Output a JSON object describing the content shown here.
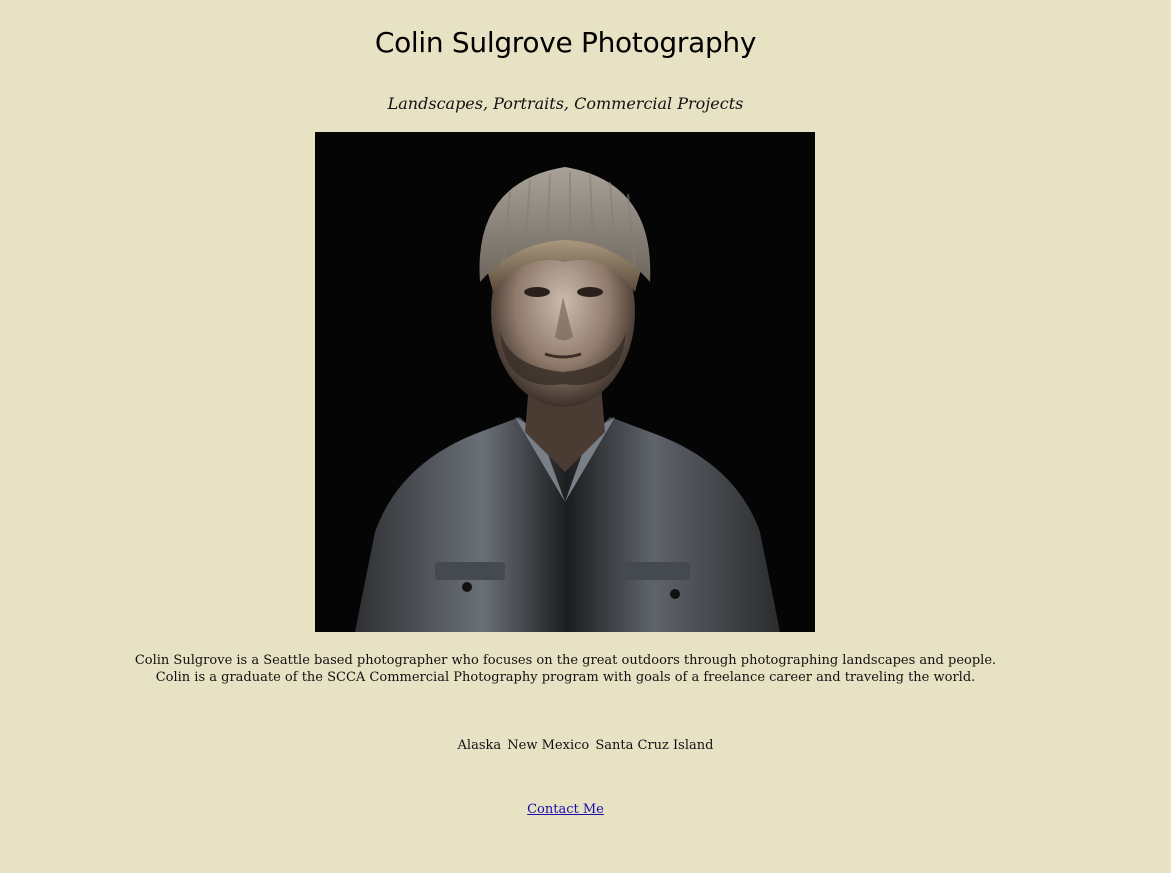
{
  "header": {
    "title": "Colin Sulgrove Photography",
    "tagline": "Landscapes, Portraits, Commercial Projects"
  },
  "portrait": {
    "subject": "portrait-photo"
  },
  "bio": {
    "line1": "Colin Sulgrove is a Seattle based photographer who focuses on the great outdoors through photographing landscapes and people.",
    "line2": "Colin is a graduate of the SCCA Commercial Photography program with goals of a freelance career and traveling the world."
  },
  "galleries": {
    "items": [
      "Alaska",
      "New Mexico",
      "Santa Cruz Island"
    ]
  },
  "contact": {
    "label": "Contact Me"
  },
  "colors": {
    "background": "#e6e2c3",
    "link": "#1a0dab",
    "photo_background": "#050505"
  }
}
